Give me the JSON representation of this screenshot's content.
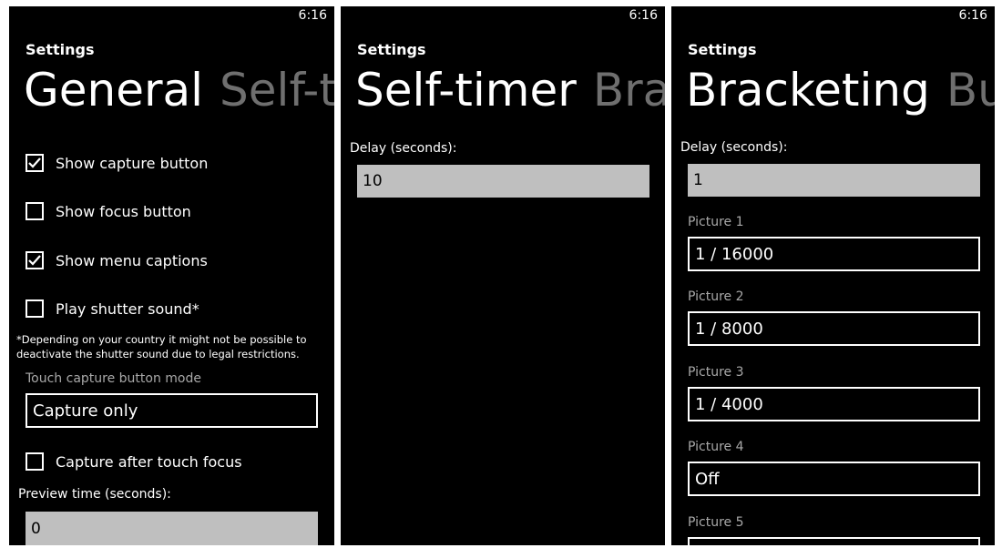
{
  "status_time": "6:16",
  "app_title": "Settings",
  "panel_general": {
    "pivot_active": "General",
    "pivot_next": "Self-ti",
    "checkboxes": [
      {
        "label": "Show capture button",
        "checked": true
      },
      {
        "label": "Show focus button",
        "checked": false
      },
      {
        "label": "Show menu captions",
        "checked": true
      },
      {
        "label": "Play shutter sound*",
        "checked": false
      }
    ],
    "note_line1": "*Depending on your country it might not be possible to",
    "note_line2": "deactivate the shutter sound due to legal restrictions.",
    "touch_mode_label": "Touch capture button mode",
    "touch_mode_value": "Capture only",
    "capture_after_focus": {
      "label": "Capture after touch focus",
      "checked": false
    },
    "preview_label": "Preview time (seconds):",
    "preview_value": "0"
  },
  "panel_selftimer": {
    "pivot_active": "Self-timer",
    "pivot_next": "Brac",
    "delay_label": "Delay (seconds):",
    "delay_value": "10"
  },
  "panel_bracketing": {
    "pivot_active": "Bracketing",
    "pivot_next": "Burs",
    "delay_label": "Delay (seconds):",
    "delay_value": "1",
    "pictures": [
      {
        "label": "Picture 1",
        "value": "1 / 16000"
      },
      {
        "label": "Picture 2",
        "value": "1 / 8000"
      },
      {
        "label": "Picture 3",
        "value": "1 / 4000"
      },
      {
        "label": "Picture 4",
        "value": "Off"
      },
      {
        "label": "Picture 5",
        "value": ""
      }
    ]
  },
  "colors": {
    "background": "#000000",
    "textbox_fill": "#bfbfbf",
    "inactive_pivot": "#6f6f6f",
    "dim_label": "#a8a8a8"
  }
}
